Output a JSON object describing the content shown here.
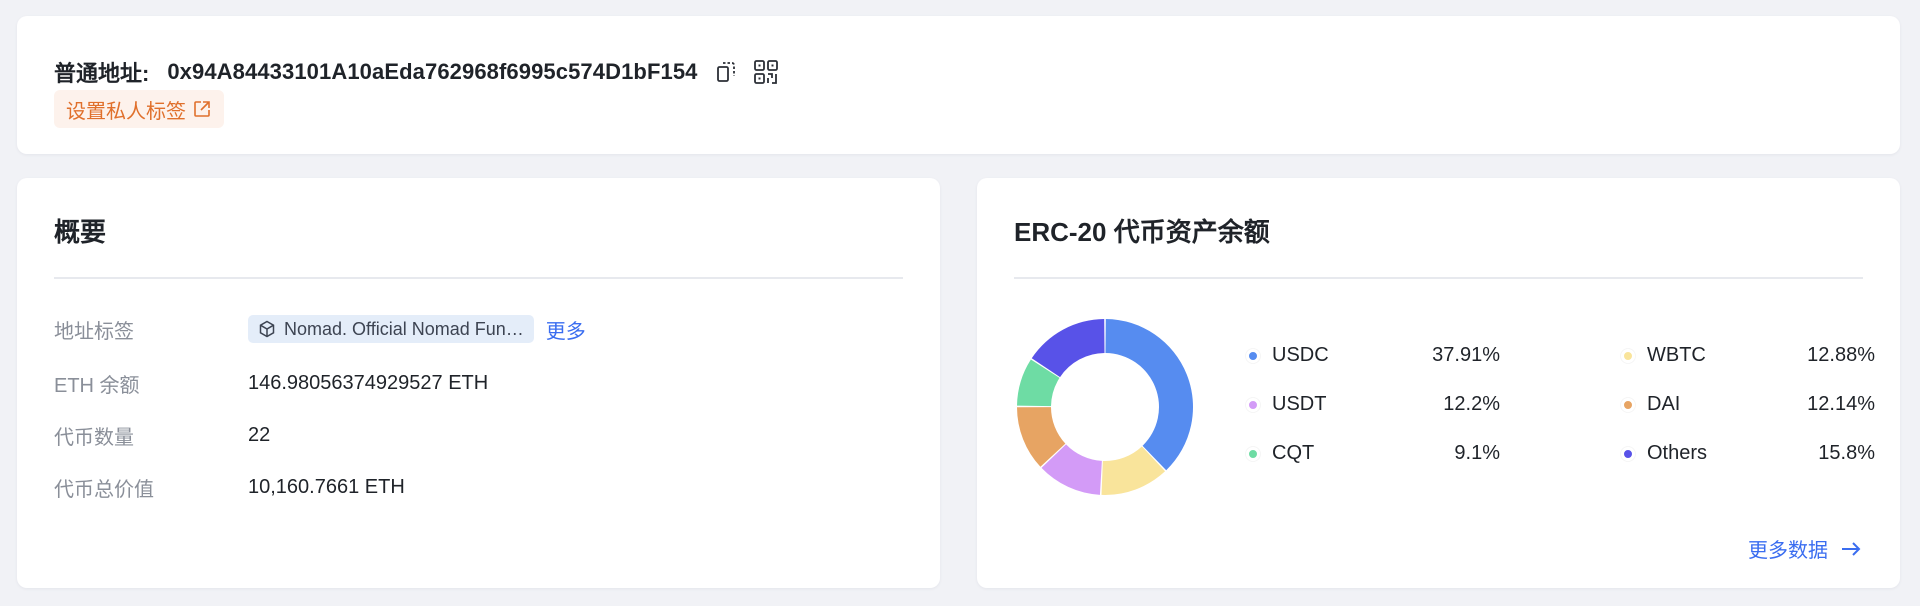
{
  "address_card": {
    "title": "普通地址:",
    "address": "0x94A84433101A10aEda762968f6995c574D1bF154",
    "set_tag_label": "设置私人标签"
  },
  "overview": {
    "title": "概要",
    "rows": [
      {
        "label": "地址标签",
        "tag_text": "Nomad. Official Nomad Fun…",
        "more_label": "更多"
      },
      {
        "label": "ETH 余额",
        "value": "146.98056374929527 ETH"
      },
      {
        "label": "代币数量",
        "value": "22"
      },
      {
        "label": "代币总价值",
        "value": "10,160.7661 ETH"
      }
    ]
  },
  "erc20": {
    "title": "ERC-20 代币资产余额",
    "more_data_label": "更多数据"
  },
  "chart_data": {
    "type": "pie",
    "donut": true,
    "categories": [
      "USDC",
      "WBTC",
      "USDT",
      "DAI",
      "CQT",
      "Others"
    ],
    "values": [
      37.91,
      12.88,
      12.2,
      12.14,
      9.1,
      15.8
    ],
    "labels": [
      "37.91%",
      "12.88%",
      "12.2%",
      "12.14%",
      "9.1%",
      "15.8%"
    ],
    "colors": [
      "#568cf0",
      "#f9e49b",
      "#d39bf7",
      "#e7a463",
      "#6edca4",
      "#5852e8"
    ],
    "legend_left": [
      {
        "name": "USDC",
        "pct": "37.91%",
        "color": "#568cf0"
      },
      {
        "name": "USDT",
        "pct": "12.2%",
        "color": "#d39bf7"
      },
      {
        "name": "CQT",
        "pct": "9.1%",
        "color": "#6edca4"
      }
    ],
    "legend_right": [
      {
        "name": "WBTC",
        "pct": "12.88%",
        "color": "#f9e49b"
      },
      {
        "name": "DAI",
        "pct": "12.14%",
        "color": "#e7a463"
      },
      {
        "name": "Others",
        "pct": "15.8%",
        "color": "#5852e8"
      }
    ],
    "legend_placement": "right"
  }
}
